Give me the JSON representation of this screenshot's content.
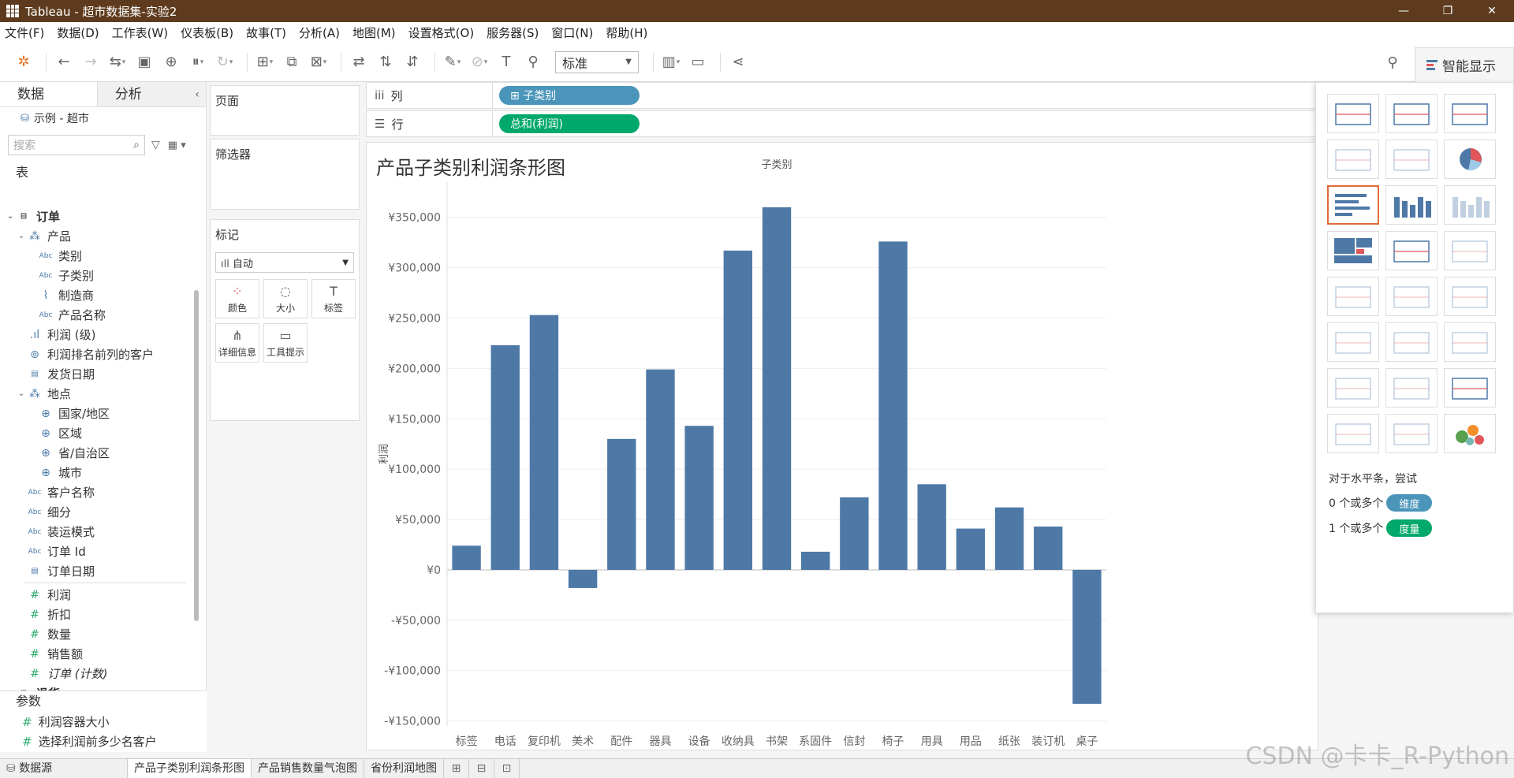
{
  "window": {
    "title": "Tableau - 超市数据集-实验2",
    "minimize": "—",
    "maximize": "❐",
    "close": "✕"
  },
  "menu": [
    "文件(F)",
    "数据(D)",
    "工作表(W)",
    "仪表板(B)",
    "故事(T)",
    "分析(A)",
    "地图(M)",
    "设置格式(O)",
    "服务器(S)",
    "窗口(N)",
    "帮助(H)"
  ],
  "toolbar": {
    "fit_value": "标准",
    "smart_show_label": "智能显示"
  },
  "data_pane": {
    "tabs": [
      "数据",
      "分析"
    ],
    "datasource": "示例 - 超市",
    "search_placeholder": "搜索",
    "tables_heading": "表",
    "tree": [
      {
        "level": 0,
        "icon": "table",
        "label": "订单",
        "bold": true,
        "toggle": "expanded"
      },
      {
        "level": 1,
        "icon": "hier",
        "label": "产品",
        "toggle": "expanded"
      },
      {
        "level": 2,
        "icon": "abc",
        "label": "类别"
      },
      {
        "level": 2,
        "icon": "abc",
        "label": "子类别"
      },
      {
        "level": 2,
        "icon": "clip",
        "label": "制造商"
      },
      {
        "level": 2,
        "icon": "abc",
        "label": "产品名称"
      },
      {
        "level": 1,
        "icon": "bin",
        "label": "利润 (级)"
      },
      {
        "level": 1,
        "icon": "set",
        "label": "利润排名前列的客户"
      },
      {
        "level": 1,
        "icon": "cal",
        "label": "发货日期"
      },
      {
        "level": 1,
        "icon": "hier",
        "label": "地点",
        "toggle": "expanded"
      },
      {
        "level": 2,
        "icon": "geo",
        "label": "国家/地区"
      },
      {
        "level": 2,
        "icon": "geo",
        "label": "区域"
      },
      {
        "level": 2,
        "icon": "geo",
        "label": "省/自治区"
      },
      {
        "level": 2,
        "icon": "geo",
        "label": "城市"
      },
      {
        "level": 1,
        "icon": "abc",
        "label": "客户名称"
      },
      {
        "level": 1,
        "icon": "abc",
        "label": "细分"
      },
      {
        "level": 1,
        "icon": "abc",
        "label": "装运模式"
      },
      {
        "level": 1,
        "icon": "abc",
        "label": "订单 Id"
      },
      {
        "level": 1,
        "icon": "cal",
        "label": "订单日期"
      },
      {
        "divider": true
      },
      {
        "level": 1,
        "icon": "hash",
        "label": "利润"
      },
      {
        "level": 1,
        "icon": "hash",
        "label": "折扣"
      },
      {
        "level": 1,
        "icon": "hash",
        "label": "数量"
      },
      {
        "level": 1,
        "icon": "hash",
        "label": "销售额"
      },
      {
        "level": 1,
        "icon": "hash",
        "label": "订单 (计数)",
        "italic": true
      },
      {
        "level": 0,
        "icon": "table",
        "label": "退货",
        "bold": true,
        "toggle": "expanded"
      }
    ],
    "params_heading": "参数",
    "params": [
      "利润容器大小",
      "选择利润前多少名客户"
    ]
  },
  "cards": {
    "pages": "页面",
    "filters": "筛选器",
    "marks": "标记",
    "mark_type": "自动",
    "mark_buttons": [
      {
        "label": "颜色",
        "icon": "⁘"
      },
      {
        "label": "大小",
        "icon": "◌"
      },
      {
        "label": "标签",
        "icon": "T"
      },
      {
        "label": "详细信息",
        "icon": "⋔"
      },
      {
        "label": "工具提示",
        "icon": "▭"
      }
    ]
  },
  "shelves": {
    "columns_label": "列",
    "columns_pill": "⊞ 子类别",
    "rows_label": "行",
    "rows_pill": "总和(利润)"
  },
  "sheet": {
    "title": "产品子类别利润条形图"
  },
  "chart_data": {
    "type": "bar",
    "header": "子类别",
    "ylabel": "利润",
    "categories": [
      "标签",
      "电话",
      "复印机",
      "美术",
      "配件",
      "器具",
      "设备",
      "收纳具",
      "书架",
      "系固件",
      "信封",
      "椅子",
      "用具",
      "用品",
      "纸张",
      "装订机",
      "桌子"
    ],
    "values": [
      24000,
      223000,
      253000,
      -18000,
      130000,
      199000,
      143000,
      317000,
      360000,
      18000,
      72000,
      326000,
      85000,
      41000,
      62000,
      43000,
      -133000
    ],
    "ylim": [
      -155000,
      385000
    ],
    "yticks": [
      -150000,
      -100000,
      -50000,
      0,
      50000,
      100000,
      150000,
      200000,
      250000,
      300000,
      350000
    ],
    "ytick_labels": [
      "-¥150,000",
      "-¥100,000",
      "-¥50,000",
      "¥0",
      "¥50,000",
      "¥100,000",
      "¥150,000",
      "¥200,000",
      "¥250,000",
      "¥300,000",
      "¥350,000"
    ],
    "bar_color": "#4e79a7",
    "grid": true
  },
  "showme": {
    "hint": "对于水平条，尝试",
    "req1_prefix": "0 个或多个",
    "req1_pill": "维度",
    "req2_prefix": "1 个或多个",
    "req2_pill": "度量",
    "dim_color": "#4a95b9",
    "meas_color": "#00a86b"
  },
  "bottom": {
    "datasource": "数据源",
    "tabs": [
      "产品子类别利润条形图",
      "产品销售数量气泡图",
      "省份利润地图"
    ],
    "active_index": 0
  },
  "watermark": "CSDN @卡卡_R-Python"
}
